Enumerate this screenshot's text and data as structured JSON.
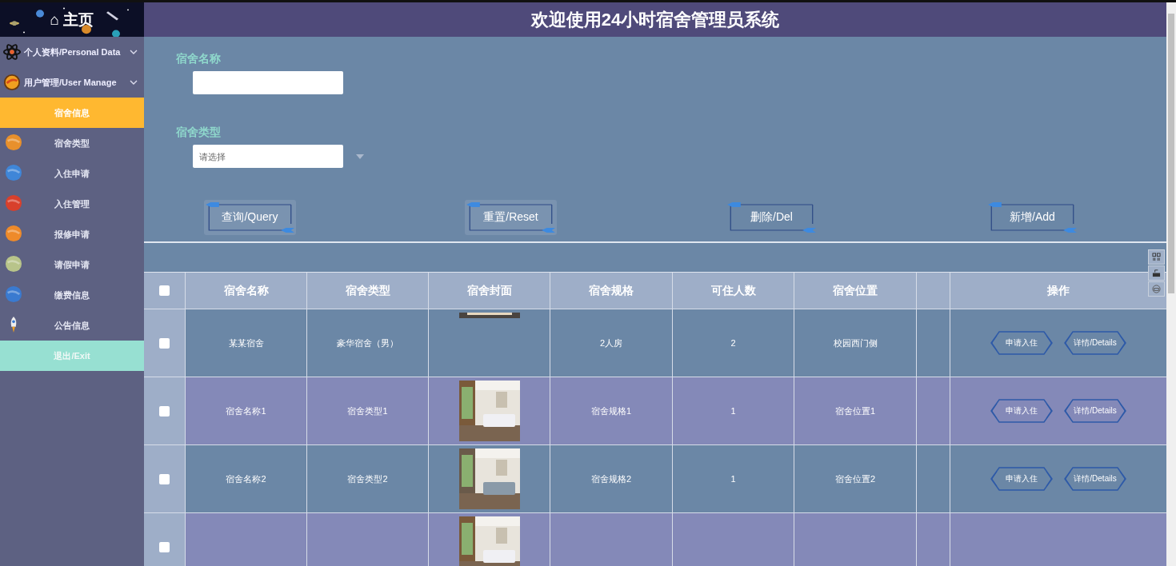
{
  "header": {
    "title": "欢迎使用24小时宿舍管理员系统"
  },
  "sidebar": {
    "home_icon": "⌂",
    "home": "主页",
    "menus": [
      {
        "label": "个人资料/Personal Data",
        "expanded": false
      },
      {
        "label": "用户管理/User Manage",
        "expanded": false
      }
    ],
    "items": [
      {
        "label": "宿舍信息",
        "selected": true
      },
      {
        "label": "宿舍类型",
        "selected": false
      },
      {
        "label": "入住申请",
        "selected": false
      },
      {
        "label": "入住管理",
        "selected": false
      },
      {
        "label": "报修申请",
        "selected": false
      },
      {
        "label": "请假申请",
        "selected": false
      },
      {
        "label": "缴费信息",
        "selected": false
      },
      {
        "label": "公告信息",
        "selected": false
      }
    ],
    "exit": "退出/Exit"
  },
  "search": {
    "fields": [
      {
        "label": "宿舍名称",
        "kind": "text"
      },
      {
        "label": "宿舍类型",
        "kind": "select",
        "placeholder": "请选择"
      }
    ],
    "buttons": [
      "查询/Query",
      "重置/Reset",
      "删除/Del",
      "新增/Add"
    ]
  },
  "table": {
    "all_checked": false,
    "columns": [
      "宿舍名称",
      "宿舍类型",
      "宿舍封面",
      "宿舍规格",
      "可住人数",
      "宿舍位置",
      "",
      "操作"
    ],
    "rows": [
      {
        "checked": false,
        "cells": [
          "某某宿舍",
          "豪华宿舍（男）",
          "",
          "2人房",
          "2",
          "校园西门侧",
          ""
        ],
        "actions": [
          "申请入住",
          "详情/Details"
        ]
      },
      {
        "checked": false,
        "cells": [
          "宿舍名称1",
          "宿舍类型1",
          "",
          "宿舍规格1",
          "1",
          "宿舍位置1",
          ""
        ],
        "actions": [
          "申请入住",
          "详情/Details"
        ]
      },
      {
        "checked": false,
        "cells": [
          "宿舍名称2",
          "宿舍类型2",
          "",
          "宿舍规格2",
          "1",
          "宿舍位置2",
          ""
        ],
        "actions": [
          "申请入住",
          "详情/Details"
        ]
      },
      {
        "checked": false,
        "cells": [
          "",
          "",
          "",
          "",
          "",
          "",
          ""
        ],
        "actions": []
      }
    ]
  }
}
